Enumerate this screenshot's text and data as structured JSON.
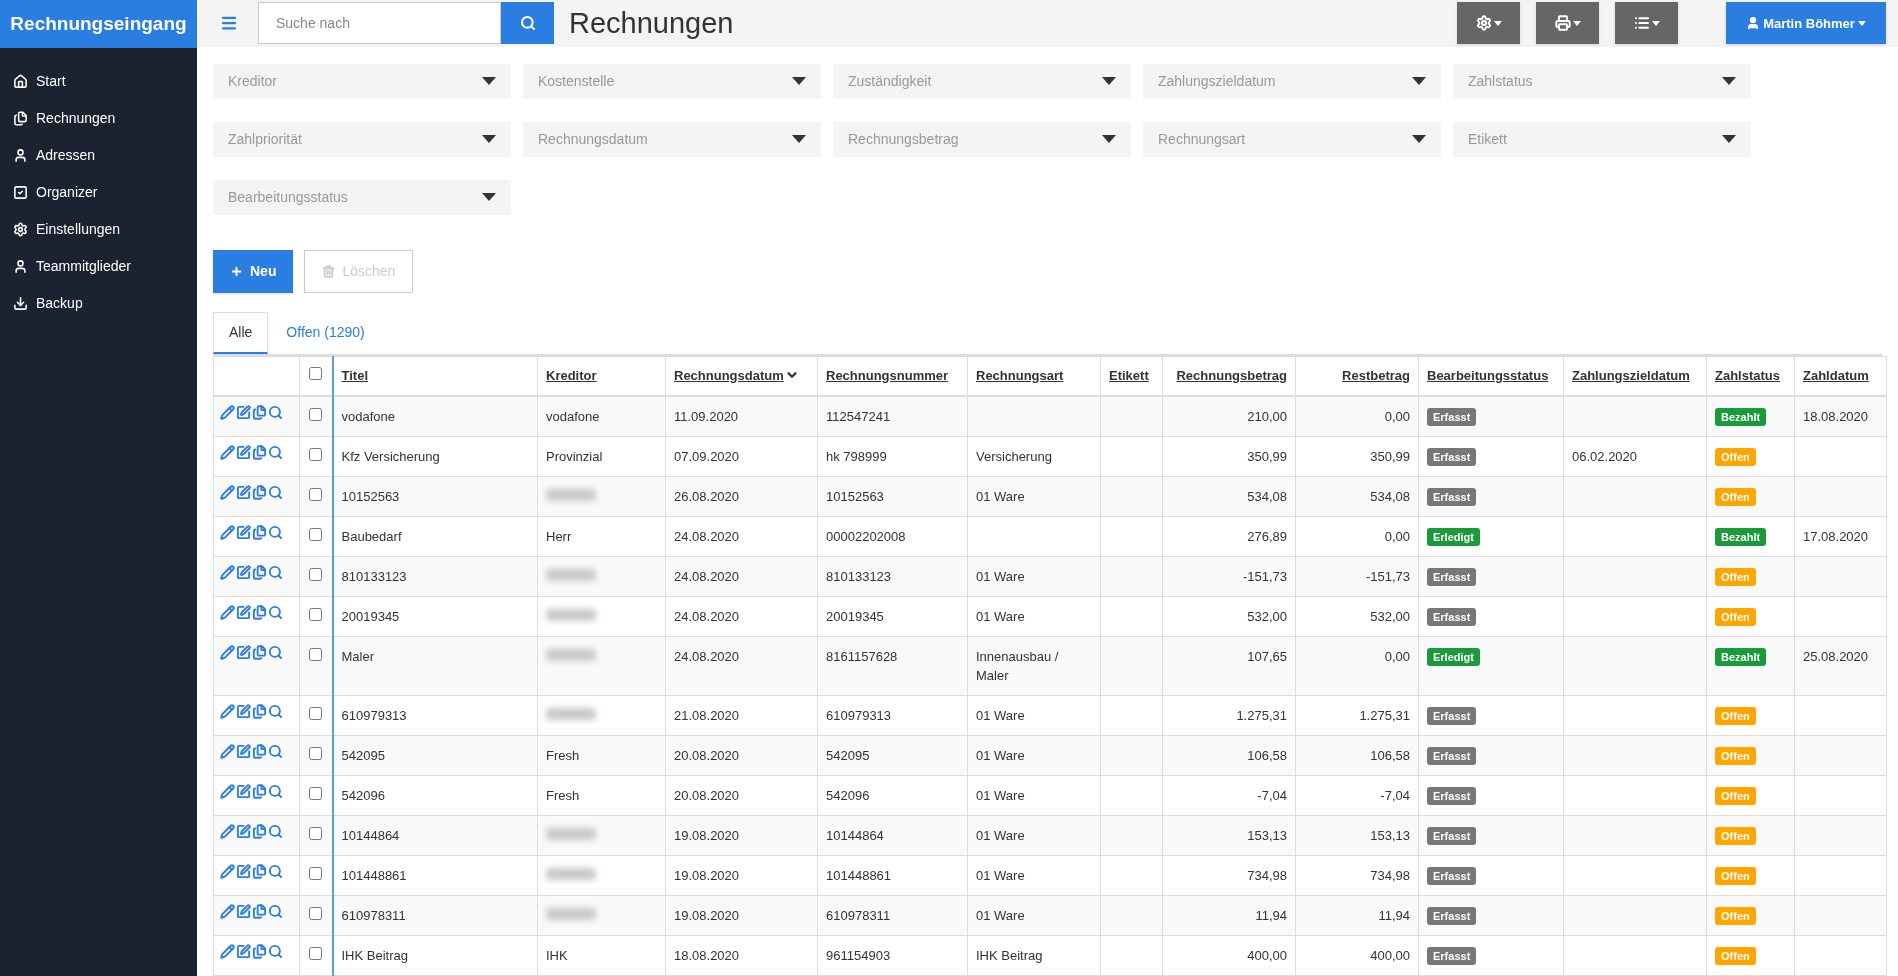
{
  "brand": "Rechnungseingang",
  "sidebar": {
    "items": [
      {
        "label": "Start"
      },
      {
        "label": "Rechnungen"
      },
      {
        "label": "Adressen"
      },
      {
        "label": "Organizer"
      },
      {
        "label": "Einstellungen"
      },
      {
        "label": "Teammitglieder"
      },
      {
        "label": "Backup"
      }
    ]
  },
  "search": {
    "placeholder": "Suche nach"
  },
  "page_title": "Rechnungen",
  "user": {
    "name": "Martin Böhmer"
  },
  "filters": [
    {
      "placeholder": "Kreditor"
    },
    {
      "placeholder": "Kostenstelle"
    },
    {
      "placeholder": "Zuständigkeit"
    },
    {
      "placeholder": "Zahlungszieldatum"
    },
    {
      "placeholder": "Zahlstatus"
    },
    {
      "placeholder": "Zahlpriorität"
    },
    {
      "placeholder": "Rechnungsdatum"
    },
    {
      "placeholder": "Rechnungsbetrag"
    },
    {
      "placeholder": "Rechnungsart"
    },
    {
      "placeholder": "Etikett"
    },
    {
      "placeholder": "Bearbeitungsstatus"
    }
  ],
  "actions": [
    {
      "label": "Neu",
      "disabled": false
    },
    {
      "label": "Löschen",
      "disabled": true
    }
  ],
  "tabs": [
    {
      "label": "Alle",
      "selected": true
    },
    {
      "label": "Offen (1290)",
      "selected": false
    }
  ],
  "table": {
    "select_all_checked": false,
    "columns": [
      {
        "label": "Titel",
        "kind": "text",
        "sorted": false
      },
      {
        "label": "Kreditor",
        "kind": "text",
        "sorted": false
      },
      {
        "label": "Rechnungsdatum",
        "kind": "text",
        "sorted": true
      },
      {
        "label": "Rechnungsnummer",
        "kind": "text",
        "sorted": false
      },
      {
        "label": "Rechnungsart",
        "kind": "text",
        "sorted": false
      },
      {
        "label": "Etikett",
        "kind": "text",
        "sorted": false
      },
      {
        "label": "Rechnungsbetrag",
        "kind": "amount",
        "sorted": false
      },
      {
        "label": "Restbetrag",
        "kind": "amount",
        "sorted": false
      },
      {
        "label": "Bearbeitungsstatus",
        "kind": "text",
        "sorted": false
      },
      {
        "label": "Zahlungszieldatum",
        "kind": "text",
        "sorted": false
      },
      {
        "label": "Zahlstatus",
        "kind": "text",
        "sorted": false
      },
      {
        "label": "Zahldatum",
        "kind": "text",
        "sorted": false
      }
    ],
    "rows": [
      {
        "checked": false,
        "titel": "vodafone",
        "kreditor": "vodafone",
        "datum": "11.09.2020",
        "nummer": "112547241",
        "betrag": "210,00",
        "rest": "0,00",
        "bearbeitung": {
          "label": "Erfasst",
          "color": "#777777"
        },
        "zahlstatus": {
          "label": "Bezahlt",
          "color": "#1a9a3a"
        },
        "zahldatum": "18.08.2020"
      },
      {
        "checked": false,
        "titel": "Kfz Versicherung",
        "kreditor": "Provinzial",
        "datum": "07.09.2020",
        "nummer": "hk 798999",
        "art": "Versicherung",
        "betrag": "350,99",
        "rest": "350,99",
        "bearbeitung": {
          "label": "Erfasst",
          "color": "#777777"
        },
        "zieldatum": "06.02.2020",
        "zahlstatus": {
          "label": "Offen",
          "color": "#ffa500"
        }
      },
      {
        "checked": false,
        "titel": "10152563",
        "kreditor_blurred": true,
        "datum": "26.08.2020",
        "nummer": "10152563",
        "art": "01 Ware",
        "betrag": "534,08",
        "rest": "534,08",
        "bearbeitung": {
          "label": "Erfasst",
          "color": "#777777"
        },
        "zahlstatus": {
          "label": "Offen",
          "color": "#ffa500"
        }
      },
      {
        "checked": false,
        "titel": "Baubedarf",
        "kreditor": "Herr",
        "datum": "24.08.2020",
        "nummer": "00002202008",
        "betrag": "276,89",
        "rest": "0,00",
        "bearbeitung": {
          "label": "Erledigt",
          "color": "#1a9a3a"
        },
        "zahlstatus": {
          "label": "Bezahlt",
          "color": "#1a9a3a"
        },
        "zahldatum": "17.08.2020"
      },
      {
        "checked": false,
        "titel": "810133123",
        "kreditor_blurred": true,
        "datum": "24.08.2020",
        "nummer": "810133123",
        "art": "01 Ware",
        "betrag": "-151,73",
        "rest": "-151,73",
        "bearbeitung": {
          "label": "Erfasst",
          "color": "#777777"
        },
        "zahlstatus": {
          "label": "Offen",
          "color": "#ffa500"
        }
      },
      {
        "checked": false,
        "titel": "20019345",
        "kreditor_blurred": true,
        "datum": "24.08.2020",
        "nummer": "20019345",
        "art": "01 Ware",
        "betrag": "532,00",
        "rest": "532,00",
        "bearbeitung": {
          "label": "Erfasst",
          "color": "#777777"
        },
        "zahlstatus": {
          "label": "Offen",
          "color": "#ffa500"
        }
      },
      {
        "checked": false,
        "titel": "Maler",
        "kreditor_blurred": true,
        "datum": "24.08.2020",
        "nummer": "8161157628",
        "art": "Innenausbau / Maler",
        "betrag": "107,65",
        "rest": "0,00",
        "bearbeitung": {
          "label": "Erledigt",
          "color": "#1a9a3a"
        },
        "zahlstatus": {
          "label": "Bezahlt",
          "color": "#1a9a3a"
        },
        "zahldatum": "25.08.2020"
      },
      {
        "checked": false,
        "titel": "610979313",
        "kreditor_blurred": true,
        "datum": "21.08.2020",
        "nummer": "610979313",
        "art": "01 Ware",
        "betrag": "1.275,31",
        "rest": "1.275,31",
        "bearbeitung": {
          "label": "Erfasst",
          "color": "#777777"
        },
        "zahlstatus": {
          "label": "Offen",
          "color": "#ffa500"
        }
      },
      {
        "checked": false,
        "titel": "542095",
        "kreditor": "Fresh",
        "datum": "20.08.2020",
        "nummer": "542095",
        "art": "01 Ware",
        "betrag": "106,58",
        "rest": "106,58",
        "bearbeitung": {
          "label": "Erfasst",
          "color": "#777777"
        },
        "zahlstatus": {
          "label": "Offen",
          "color": "#ffa500"
        }
      },
      {
        "checked": false,
        "titel": "542096",
        "kreditor": "Fresh",
        "datum": "20.08.2020",
        "nummer": "542096",
        "art": "01 Ware",
        "betrag": "-7,04",
        "rest": "-7,04",
        "bearbeitung": {
          "label": "Erfasst",
          "color": "#777777"
        },
        "zahlstatus": {
          "label": "Offen",
          "color": "#ffa500"
        }
      },
      {
        "checked": false,
        "titel": "10144864",
        "kreditor_blurred": true,
        "datum": "19.08.2020",
        "nummer": "10144864",
        "art": "01 Ware",
        "betrag": "153,13",
        "rest": "153,13",
        "bearbeitung": {
          "label": "Erfasst",
          "color": "#777777"
        },
        "zahlstatus": {
          "label": "Offen",
          "color": "#ffa500"
        }
      },
      {
        "checked": false,
        "titel": "101448861",
        "kreditor_blurred": true,
        "datum": "19.08.2020",
        "nummer": "101448861",
        "art": "01 Ware",
        "betrag": "734,98",
        "rest": "734,98",
        "bearbeitung": {
          "label": "Erfasst",
          "color": "#777777"
        },
        "zahlstatus": {
          "label": "Offen",
          "color": "#ffa500"
        }
      },
      {
        "checked": false,
        "titel": "610978311",
        "kreditor_blurred": true,
        "datum": "19.08.2020",
        "nummer": "610978311",
        "art": "01 Ware",
        "betrag": "11,94",
        "rest": "11,94",
        "bearbeitung": {
          "label": "Erfasst",
          "color": "#777777"
        },
        "zahlstatus": {
          "label": "Offen",
          "color": "#ffa500"
        }
      },
      {
        "checked": false,
        "titel": "IHK Beitrag",
        "kreditor": "IHK",
        "datum": "18.08.2020",
        "nummer": "961154903",
        "art": "IHK Beitrag",
        "betrag": "400,00",
        "rest": "400,00",
        "bearbeitung": {
          "label": "Erfasst",
          "color": "#777777"
        },
        "zahlstatus": {
          "label": "Offen",
          "color": "#ffa500"
        }
      }
    ]
  }
}
